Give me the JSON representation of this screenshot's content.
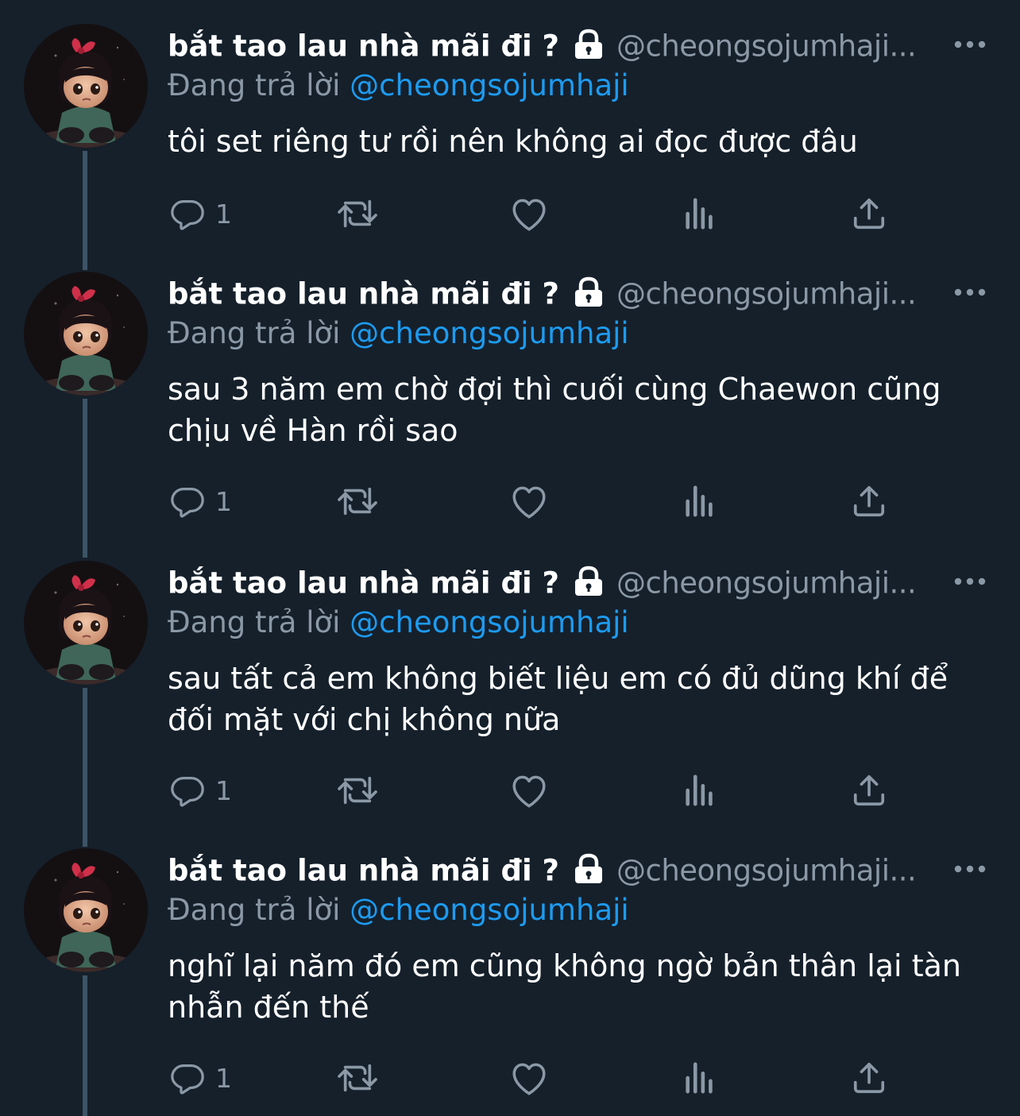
{
  "colors": {
    "background": "#15202b",
    "secondary_text": "#8b98a5",
    "mention": "#1d9bf0",
    "thread_line": "#3d5466"
  },
  "tweets": [
    {
      "display_name": "bắt tao lau nhà mãi đi ?",
      "handle": "@cheongsojumhaji...",
      "reply_prefix": "Đang trả lời",
      "reply_handle": "@cheongsojumhaji",
      "text": "tôi set riêng tư rồi nên không ai đọc được đâu",
      "reply_count": "1"
    },
    {
      "display_name": "bắt tao lau nhà mãi đi ?",
      "handle": "@cheongsojumhaji...",
      "reply_prefix": "Đang trả lời",
      "reply_handle": "@cheongsojumhaji",
      "text": "sau 3 năm em chờ đợi thì cuối cùng Chaewon cũng chịu về Hàn rồi sao",
      "reply_count": "1"
    },
    {
      "display_name": "bắt tao lau nhà mãi đi ?",
      "handle": "@cheongsojumhaji...",
      "reply_prefix": "Đang trả lời",
      "reply_handle": "@cheongsojumhaji",
      "text": "sau tất cả em không biết liệu em có đủ dũng khí để đối mặt với chị không nữa",
      "reply_count": "1"
    },
    {
      "display_name": "bắt tao lau nhà mãi đi ?",
      "handle": "@cheongsojumhaji...",
      "reply_prefix": "Đang trả lời",
      "reply_handle": "@cheongsojumhaji",
      "text": "nghĩ lại năm đó em cũng không ngờ bản thân lại tàn nhẫn đến thế",
      "reply_count": "1"
    }
  ],
  "icons": {
    "lock": "lock-icon",
    "more": "more-icon",
    "reply": "reply-icon",
    "retweet": "retweet-icon",
    "like": "heart-icon",
    "views": "views-icon",
    "share": "share-icon"
  }
}
